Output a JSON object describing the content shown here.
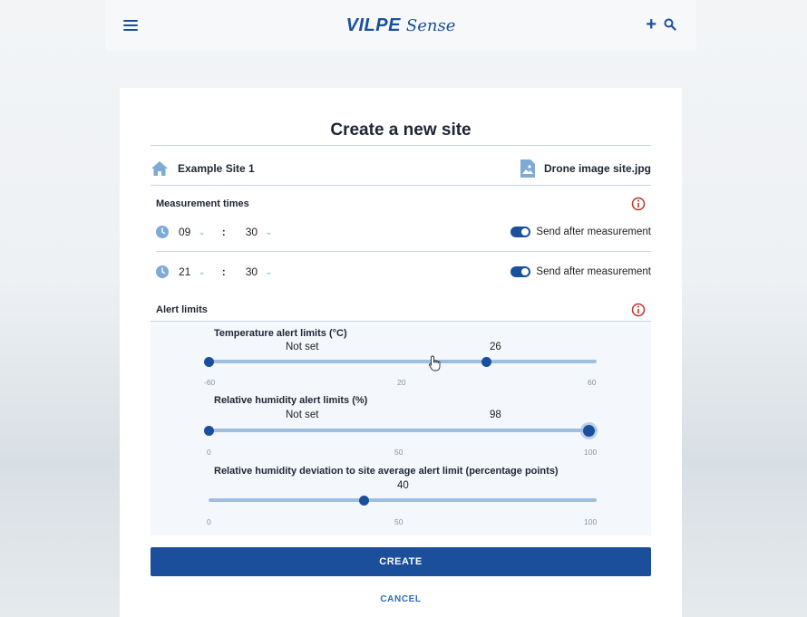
{
  "header": {
    "logo_main": "VILPE",
    "logo_sub": "Sense",
    "plus_label": "+"
  },
  "form": {
    "title": "Create a new site",
    "site_name": "Example Site 1",
    "image_name": "Drone image site.jpg",
    "measurement_label": "Measurement times",
    "times": [
      {
        "hour": "09",
        "minute": "30",
        "colon": ":",
        "toggle_label": "Send after measurement",
        "send": true
      },
      {
        "hour": "21",
        "minute": "30",
        "colon": ":",
        "toggle_label": "Send after measurement",
        "send": true
      }
    ],
    "alert_label": "Alert limits",
    "sliders": [
      {
        "title": "Temperature alert limits (°C)",
        "low_label": "Not set",
        "high_label": "26",
        "min": -60,
        "max": 60,
        "mid": 20,
        "min_label": "-60",
        "mid_label": "20",
        "max_label": "60",
        "low": -60,
        "high": 26
      },
      {
        "title": "Relative humidity alert limits (%)",
        "low_label": "Not set",
        "high_label": "98",
        "min": 0,
        "max": 100,
        "mid": 50,
        "min_label": "0",
        "mid_label": "50",
        "max_label": "100",
        "low": 0,
        "high": 98
      },
      {
        "title": "Relative humidity deviation to site average alert limit (percentage points)",
        "value_label": "40",
        "min": 0,
        "max": 100,
        "mid": 50,
        "min_label": "0",
        "mid_label": "50",
        "max_label": "100",
        "value": 40
      }
    ],
    "create_label": "CREATE",
    "cancel_label": "CANCEL"
  },
  "colors": {
    "primary": "#1b4f9c",
    "track": "#9fbfe0",
    "info": "#c0312b",
    "icon_light": "#7fa9d6"
  }
}
